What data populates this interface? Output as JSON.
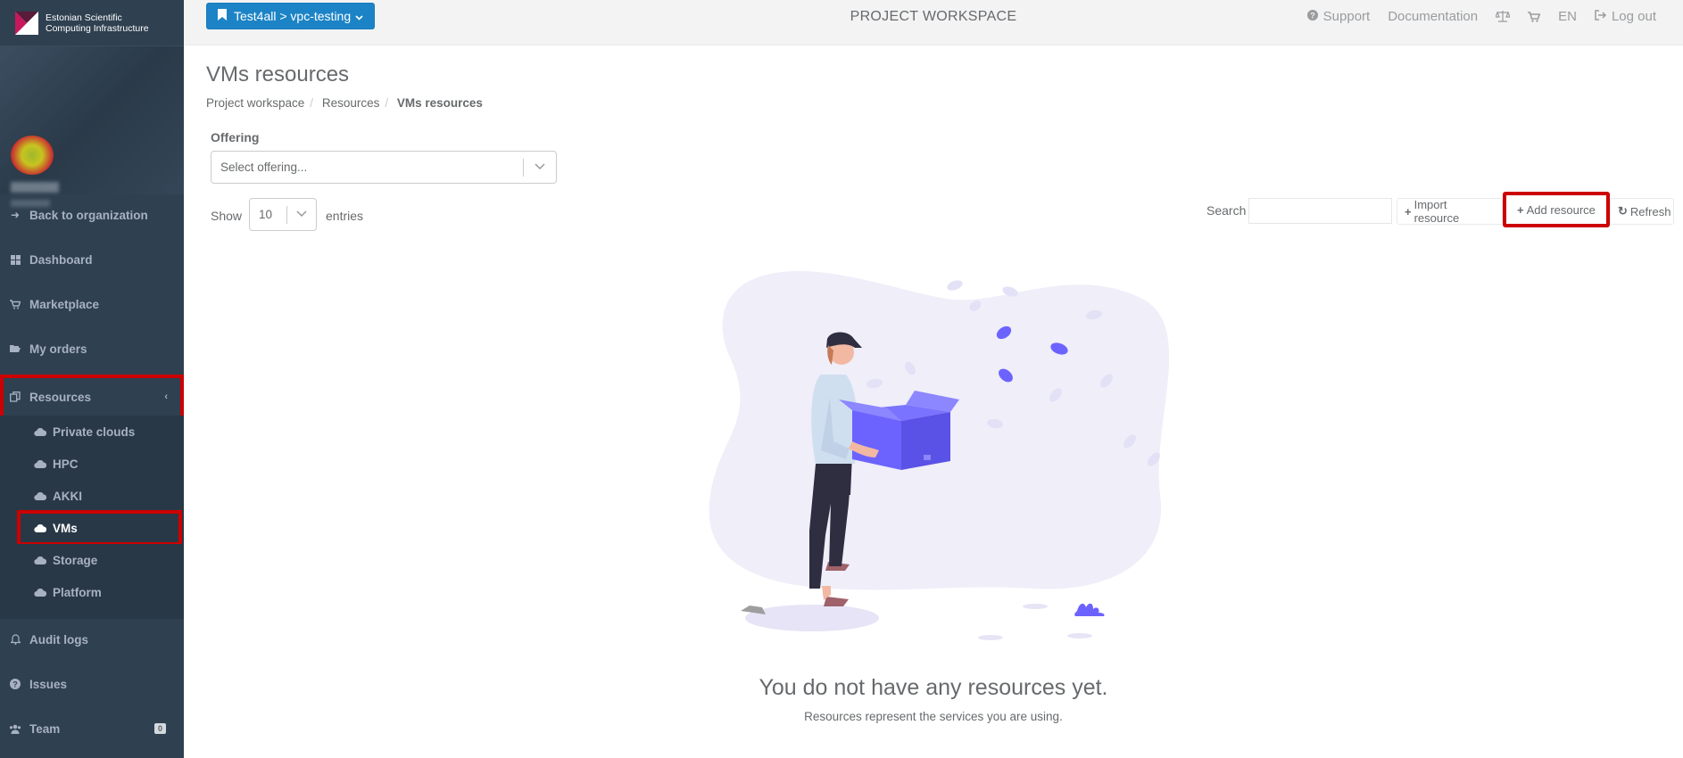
{
  "brand": {
    "line1": "Estonian Scientific",
    "line2": "Computing Infrastructure"
  },
  "sidebar": {
    "items": [
      {
        "label": "Back to organization",
        "icon": "arrow-left-icon"
      },
      {
        "label": "Dashboard",
        "icon": "th-large-icon"
      },
      {
        "label": "Marketplace",
        "icon": "shopping-cart-icon"
      },
      {
        "label": "My orders",
        "icon": "folder-open-icon"
      },
      {
        "label": "Resources",
        "icon": "copy-icon"
      },
      {
        "label": "Audit logs",
        "icon": "bell-icon"
      },
      {
        "label": "Issues",
        "icon": "question-circle-icon"
      },
      {
        "label": "Team",
        "icon": "users-icon",
        "badge": "0"
      }
    ],
    "sub_items": [
      {
        "label": "Private clouds",
        "icon": "cloud-icon"
      },
      {
        "label": "HPC",
        "icon": "cloud-icon"
      },
      {
        "label": "AKKI",
        "icon": "cloud-icon"
      },
      {
        "label": "VMs",
        "icon": "cloud-icon",
        "active": true
      },
      {
        "label": "Storage",
        "icon": "cloud-icon"
      },
      {
        "label": "Platform",
        "icon": "cloud-icon"
      }
    ]
  },
  "topbar": {
    "workspace_button": "Test4all > vpc-testing",
    "title": "PROJECT WORKSPACE",
    "support": "Support",
    "documentation": "Documentation",
    "language": "EN",
    "logout": "Log out"
  },
  "main": {
    "title": "VMs resources",
    "breadcrumb": [
      "Project workspace",
      "Resources",
      "VMs resources"
    ],
    "offering_label": "Offering",
    "offering_placeholder": "Select offering...",
    "show_label": "Show",
    "page_length": "10",
    "entries_label": "entries",
    "search_label": "Search",
    "search_value": "",
    "import_button": "Import resource",
    "add_button": "Add resource",
    "refresh_button": "Refresh",
    "empty_title": "You do not have any resources yet.",
    "empty_subtitle": "Resources represent the services you are using."
  },
  "colors": {
    "sidebar_bg": "#2f4050",
    "primary": "#1c84c6",
    "highlight_box": "#cc0000",
    "illustration_accent": "#6c63ff"
  }
}
